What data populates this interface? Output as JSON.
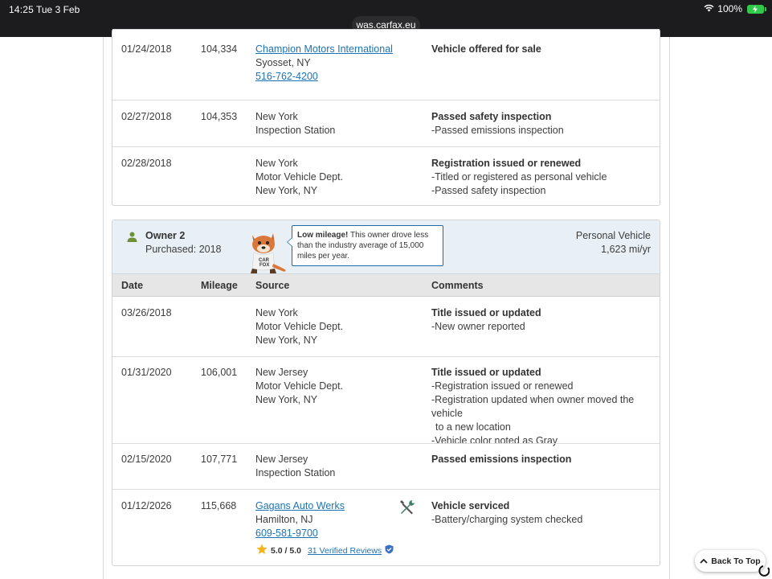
{
  "status_bar": {
    "time": "14:25",
    "date": "Tue 3 Feb",
    "battery_percent": "100%",
    "url": "was.carfax.eu"
  },
  "owner1_records": [
    {
      "date": "01/24/2018",
      "mileage": "104,334",
      "source_link": "Champion Motors International",
      "source_lines": [
        "Syosset, NY"
      ],
      "source_phone": "516-762-4200",
      "comment_title": "Vehicle offered for sale",
      "comment_items": []
    },
    {
      "date": "02/27/2018",
      "mileage": "104,353",
      "source_lines": [
        "New York",
        "Inspection Station"
      ],
      "comment_title": "Passed safety inspection",
      "comment_items": [
        "Passed emissions inspection"
      ]
    },
    {
      "date": "02/28/2018",
      "mileage": "",
      "source_lines": [
        "New York",
        "Motor Vehicle Dept.",
        "New York, NY"
      ],
      "comment_title": "Registration issued or renewed",
      "comment_items": [
        "Titled or registered as personal vehicle",
        "Passed safety inspection"
      ]
    }
  ],
  "owner2": {
    "title": "Owner 2",
    "purchased": "Purchased: 2018",
    "tip_bold": "Low mileage!",
    "tip_text": " This owner drove less than the industry average of 15,000 miles per year.",
    "usage_type": "Personal Vehicle",
    "usage_rate": "1,623 mi/yr",
    "icons": {
      "owner": "person-icon",
      "mascot": "carfox-mascot-icon"
    }
  },
  "table_headers": {
    "date": "Date",
    "mileage": "Mileage",
    "source": "Source",
    "comments": "Comments"
  },
  "owner2_records": [
    {
      "date": "03/26/2018",
      "mileage": "",
      "source_lines": [
        "New York",
        "Motor Vehicle Dept.",
        "New York, NY"
      ],
      "comment_title": "Title issued or updated",
      "comment_items": [
        "New owner reported"
      ]
    },
    {
      "date": "01/31/2020",
      "mileage": "106,001",
      "source_lines": [
        "New Jersey",
        "Motor Vehicle Dept.",
        "New York, NY"
      ],
      "comment_title": "Title issued or updated",
      "comment_items": [
        "Registration issued or renewed",
        "Registration updated when owner moved the vehicle",
        "to a new location",
        "Vehicle color noted as Gray"
      ]
    },
    {
      "date": "02/15/2020",
      "mileage": "107,771",
      "source_lines": [
        "New Jersey",
        "Inspection Station"
      ],
      "comment_title": "Passed emissions inspection",
      "comment_items": []
    },
    {
      "date": "01/12/2026",
      "mileage": "115,668",
      "source_link": "Gagans Auto Werks",
      "source_lines": [
        "Hamilton, NJ"
      ],
      "source_phone": "609-581-9700",
      "rating_score": "5.0 / 5.0",
      "rating_reviews": "31 Verified Reviews",
      "comment_title": "Vehicle serviced",
      "comment_items": [
        "Battery/charging system checked"
      ]
    }
  ],
  "back_to_top": "Back To Top",
  "colors": {
    "link": "#1a73b8",
    "owner_header_bg": "#e9f0f5",
    "table_header_bg": "#e6e6e6",
    "tooltip_border": "#1f6aa5"
  }
}
